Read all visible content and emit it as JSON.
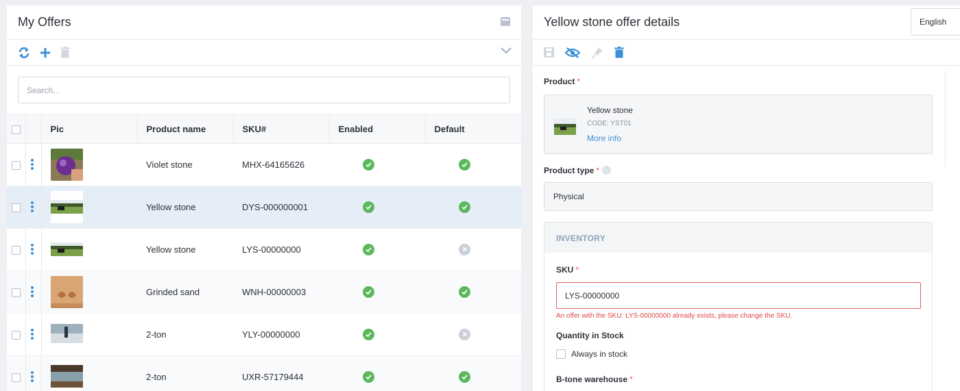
{
  "left": {
    "title": "My Offers",
    "search_placeholder": "Search...",
    "columns": {
      "pic": "Pic",
      "name": "Product name",
      "sku": "SKU#",
      "enabled": "Enabled",
      "default": "Default"
    },
    "rows": [
      {
        "name": "Violet stone",
        "sku": "MHX-64165626",
        "enabled": true,
        "default": true,
        "thumb": "violet"
      },
      {
        "name": "Yellow stone",
        "sku": "DYS-000000001",
        "enabled": true,
        "default": true,
        "thumb": "field"
      },
      {
        "name": "Yellow stone",
        "sku": "LYS-00000000",
        "enabled": true,
        "default": false,
        "thumb": "field"
      },
      {
        "name": "Grinded sand",
        "sku": "WNH-00000003",
        "enabled": true,
        "default": true,
        "thumb": "sand"
      },
      {
        "name": "2-ton",
        "sku": "YLY-00000000",
        "enabled": true,
        "default": false,
        "thumb": "rock"
      },
      {
        "name": "2-ton",
        "sku": "UXR-57179444",
        "enabled": true,
        "default": true,
        "thumb": "river"
      }
    ]
  },
  "right": {
    "title": "Yellow stone offer details",
    "language": "English",
    "product_label": "Product",
    "required_mark": "*",
    "product": {
      "name": "Yellow stone",
      "code": "CODE: YST01",
      "more": "More info"
    },
    "product_type_label": "Product type",
    "product_type_value": "Physical",
    "inventory_title": "INVENTORY",
    "sku_label": "SKU",
    "sku_value": "LYS-00000000",
    "sku_error": "An offer with the SKU: LYS-00000000 already exists, please change the SKU.",
    "qty_label": "Quantity in Stock",
    "always_label": "Always in stock",
    "warehouse_label": "B-tone warehouse"
  },
  "colors": {
    "accent": "#3b8fd6",
    "enabled": "#5cb85c",
    "disabled": "#c9d0d8",
    "error": "#e04646",
    "selected_row": "#e5eef7"
  }
}
